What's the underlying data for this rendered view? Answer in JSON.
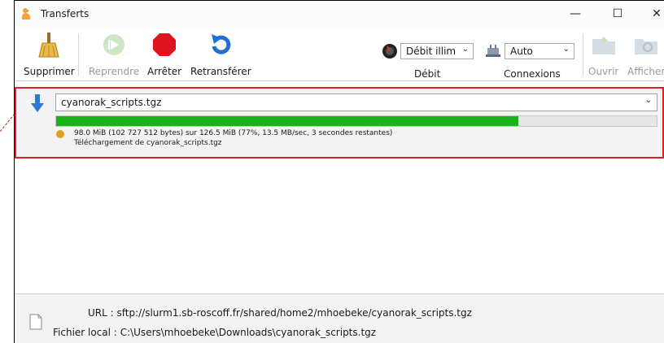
{
  "window": {
    "title": "Transferts",
    "controls": {
      "minimize": "—",
      "maximize": "☐",
      "close": "✕"
    }
  },
  "toolbar": {
    "delete_label": "Supprimer",
    "resume_label": "Reprendre",
    "stop_label": "Arrêter",
    "retransfer_label": "Retransférer",
    "rate_value": "Débit illim",
    "rate_label": "Débit",
    "connections_value": "Auto",
    "connections_label": "Connexions",
    "open_label": "Ouvrir",
    "show_label": "Afficher"
  },
  "transfer": {
    "filename": "cyanorak_scripts.tgz",
    "progress": 0.77,
    "status_line": "98.0 MiB (102 727 512 bytes) sur 126.5 MiB (77%, 13.5 MB/sec, 3 secondes restantes)",
    "action_line": "Téléchargement de cyanorak_scripts.tgz"
  },
  "details": {
    "url_label": "URL :",
    "url_value": "sftp://slurm1.sb-roscoff.fr/shared/home2/mhoebeke/cyanorak_scripts.tgz",
    "local_label": "Fichier local :",
    "local_value": "C:\\Users\\mhoebeke\\Downloads\\cyanorak_scripts.tgz"
  },
  "colors": {
    "progress_fill": "#17b317",
    "highlight_border": "#e02020",
    "status_dot": "#e0a21c",
    "stop_red": "#e0141e",
    "retransfer_blue": "#1e6fd0"
  }
}
